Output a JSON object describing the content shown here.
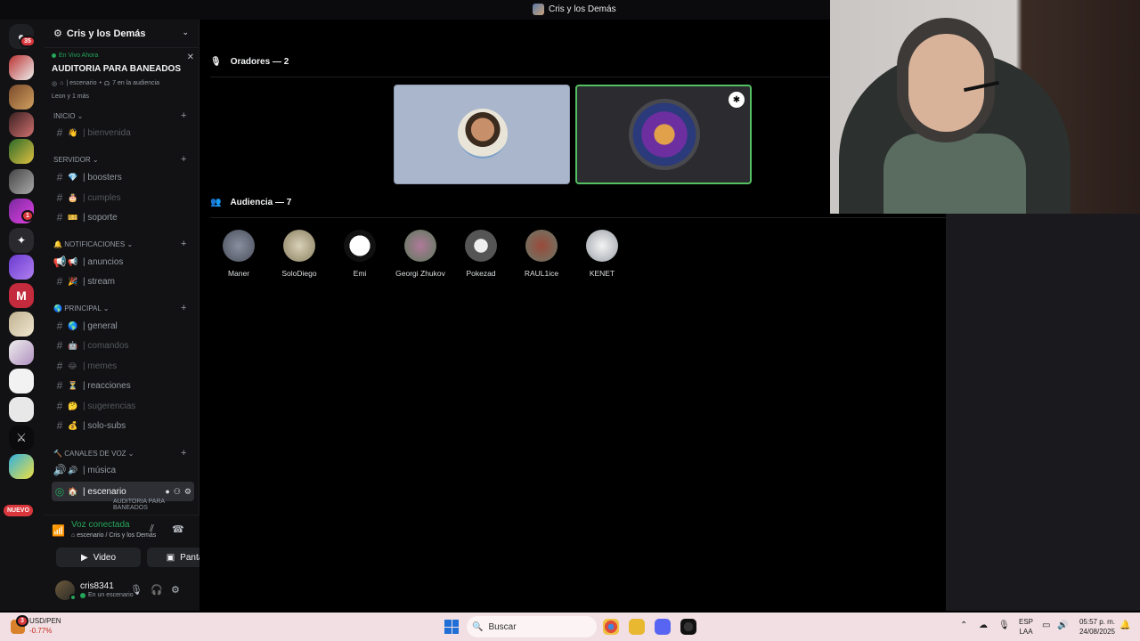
{
  "window": {
    "title": "Cris y los Demás"
  },
  "rail": {
    "home_badge": "35",
    "server_badge": "1",
    "nuevo_label": "NUEVO"
  },
  "server": {
    "name": "Cris y los Demás"
  },
  "live": {
    "tag": "En Vivo Ahora",
    "name": "AUDITORIA PARA BANEADOS",
    "channel": "| escenario",
    "dot": "•",
    "audience": "7 en la audiencia",
    "listeners": "Leon y 1 más"
  },
  "categories": {
    "inicio": "INICIO",
    "servidor": "SERVIDOR",
    "notificaciones": "NOTIFICACIONES",
    "principal": "PRINCIPAL",
    "voz": "CANALES DE VOZ"
  },
  "channels": {
    "bienvenida": "| bienvenida",
    "boosters": "| boosters",
    "cumples": "| cumples",
    "soporte": "| soporte",
    "anuncios": "| anuncios",
    "stream": "| stream",
    "general": "| general",
    "comandos": "| comandos",
    "memes": "| memes",
    "reacciones": "| reacciones",
    "sugerencias": "| sugerencias",
    "solo_subs": "| solo-subs",
    "musica": "| música",
    "escenario": "| escenario",
    "escenario_sub": "AUDITORIA PARA BANEADOS"
  },
  "voice": {
    "status": "Voz conectada",
    "location": "escenario / Cris y los Demás",
    "video_label": "Video",
    "screen_label": "Pantalla"
  },
  "user": {
    "name": "cris8341",
    "status": "En un escenario"
  },
  "stage": {
    "speakers_title": "Oradores — 2",
    "audience_title": "Audiencia — 7",
    "audience": [
      "Maner",
      "SoloDiego",
      "Emi",
      "Georgi Zhukov",
      "Pokezad",
      "RAUL1ice",
      "KENET"
    ]
  },
  "taskbar": {
    "fx_pair": "USD/PEN",
    "fx_change": "-0.77%",
    "fx_badge": "3",
    "search_placeholder": "Buscar",
    "lang_top": "ESP",
    "lang_bottom": "LAA",
    "time": "05:57 p. m.",
    "date": "24/08/2025"
  },
  "colors": {
    "accent_green": "#23a55a",
    "badge_red": "#da373c",
    "speaking_border": "#53c162"
  }
}
